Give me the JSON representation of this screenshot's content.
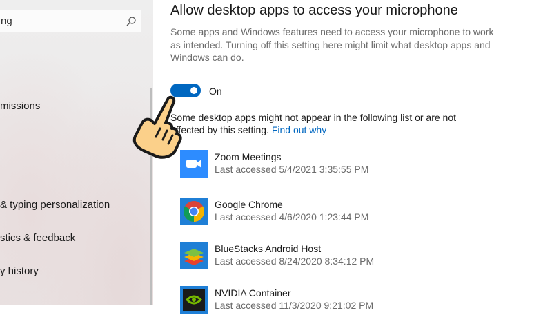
{
  "sidebar": {
    "search": {
      "value": "ng",
      "icon": "search-icon"
    },
    "items": [
      {
        "label": "missions"
      },
      {
        "label": "& typing personalization"
      },
      {
        "label": "stics & feedback"
      },
      {
        "label": "y history"
      }
    ]
  },
  "main": {
    "title": "Allow desktop apps to access your microphone",
    "description": "Some apps and Windows features need to access your microphone to work as intended. Turning off this setting here might limit what desktop apps and Windows can do.",
    "toggle": {
      "state": "On",
      "on": true
    },
    "note": "Some desktop apps might not appear in the following list or are not affected by this setting.",
    "note_link": "Find out why",
    "apps": [
      {
        "name": "Zoom Meetings",
        "last_accessed": "Last accessed 5/4/2021 3:35:55 PM",
        "icon": "zoom-icon"
      },
      {
        "name": "Google Chrome",
        "last_accessed": "Last accessed 4/6/2020 1:23:44 PM",
        "icon": "chrome-icon"
      },
      {
        "name": "BlueStacks Android Host",
        "last_accessed": "Last accessed 8/24/2020 8:34:12 PM",
        "icon": "bluestacks-icon"
      },
      {
        "name": "NVIDIA Container",
        "last_accessed": "Last accessed 11/3/2020 9:21:02 PM",
        "icon": "nvidia-icon"
      }
    ]
  },
  "colors": {
    "accent": "#0067c0",
    "zoom": "#2d8cff",
    "nvidia": "#76b900"
  },
  "overlay": {
    "icon": "pointing-hand-icon"
  }
}
